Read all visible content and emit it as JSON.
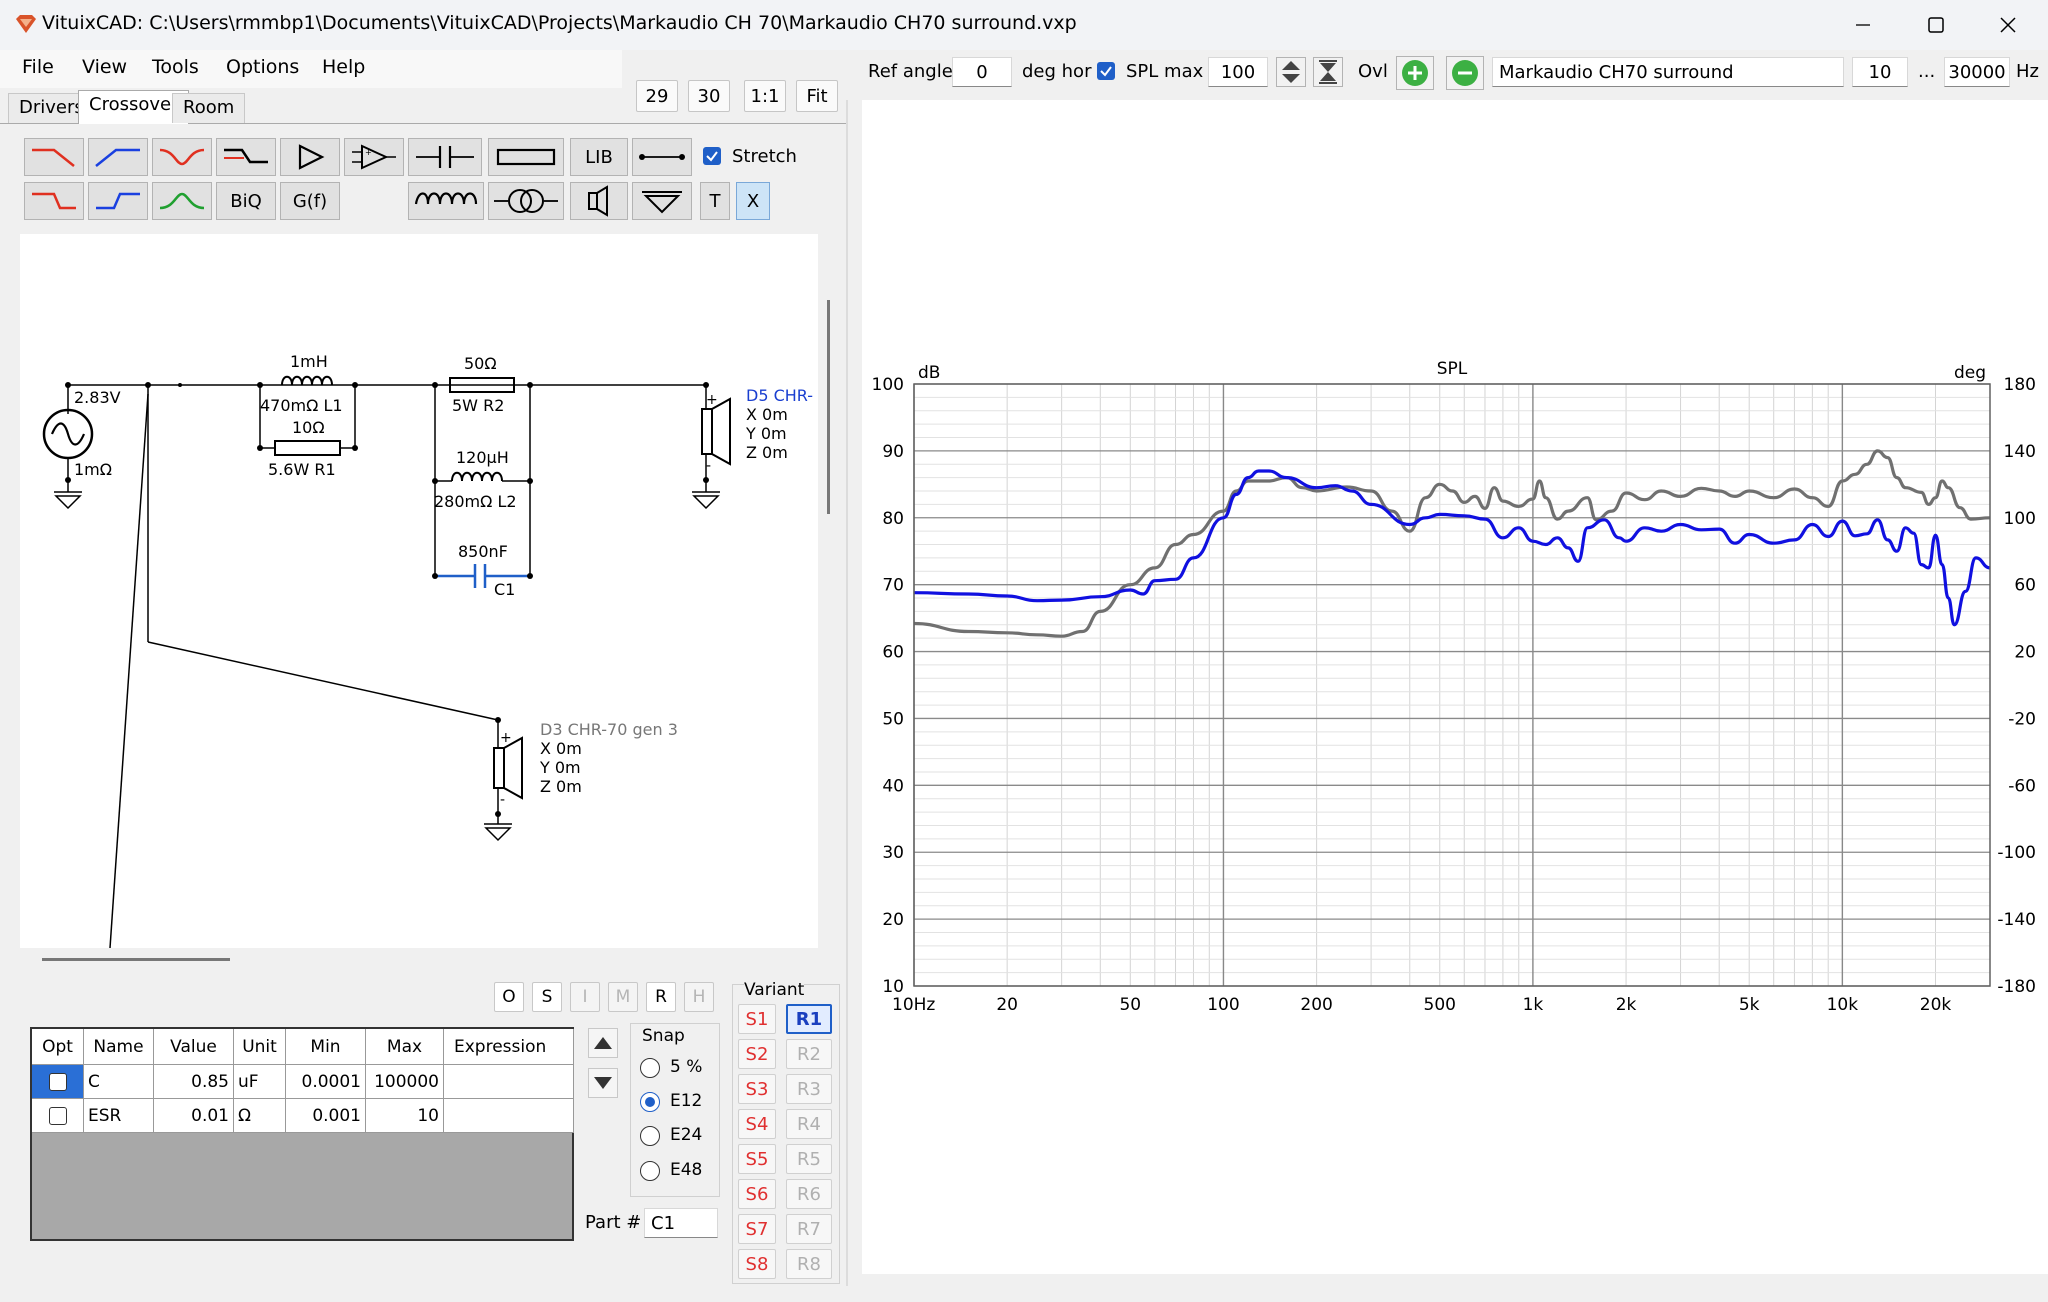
{
  "window": {
    "title": "VituixCAD: C:\\Users\\rmmbp1\\Documents\\VituixCAD\\Projects\\Markaudio CH 70\\Markaudio CH70 surround.vxp"
  },
  "menu": {
    "file": "File",
    "view": "View",
    "tools": "Tools",
    "options": "Options",
    "help": "Help"
  },
  "tabs": {
    "drivers": "Drivers",
    "crossover": "Crossover",
    "room": "Room",
    "active": "Crossover"
  },
  "zoom_buttons": {
    "b29": "29",
    "b30": "30",
    "b11": "1:1",
    "fit": "Fit"
  },
  "toolbar": {
    "lib": "LIB",
    "biq": "BiQ",
    "gf": "G(f)",
    "t": "T",
    "x": "X",
    "stretch_label": "Stretch",
    "stretch_checked": true
  },
  "schematic": {
    "source_voltage": "2.83V",
    "source_impedance": "1mΩ",
    "l1_value": "1mH",
    "l1_label": "470mΩ L1",
    "r1_value": "10Ω",
    "r1_label": "5.6W  R1",
    "r2_value": "50Ω",
    "r2_label": "5W   R2",
    "l2_value": "120µH",
    "l2_label": "280mΩ L2",
    "c1_value": "850nF",
    "c1_label": "C1",
    "d5_name": "D5 CHR-",
    "d5_x": "X 0m",
    "d5_y": "Y 0m",
    "d5_z": "Z 0m",
    "d3_name": "D3 CHR-70 gen 3",
    "d3_x": "X 0m",
    "d3_y": "Y 0m",
    "d3_z": "Z 0m"
  },
  "part_buttons": {
    "o": "O",
    "s": "S",
    "i": "I",
    "m": "M",
    "r": "R",
    "h": "H"
  },
  "param_table": {
    "headers": [
      "Opt",
      "Name",
      "Value",
      "Unit",
      "Min",
      "Max",
      "Expression"
    ],
    "rows": [
      {
        "opt": false,
        "name": "C",
        "value": "0.85",
        "unit": "uF",
        "min": "0.0001",
        "max": "100000",
        "expression": ""
      },
      {
        "opt": false,
        "name": "ESR",
        "value": "0.01",
        "unit": "Ω",
        "min": "0.001",
        "max": "10",
        "expression": ""
      }
    ]
  },
  "snap": {
    "label": "Snap",
    "options": [
      "5 %",
      "E12",
      "E24",
      "E48"
    ],
    "selected": "E12"
  },
  "part_number": {
    "label": "Part #",
    "value": "C1"
  },
  "variant": {
    "label": "Variant",
    "s": [
      "S1",
      "S2",
      "S3",
      "S4",
      "S5",
      "S6",
      "S7",
      "S8"
    ],
    "r": [
      "R1",
      "R2",
      "R3",
      "R4",
      "R5",
      "R6",
      "R7",
      "R8"
    ],
    "active": "R1"
  },
  "graph_toolbar": {
    "ref_angle_label": "Ref angle",
    "ref_angle_value": "0",
    "deg_hor_label": "deg hor",
    "spl_max_checked": true,
    "spl_max_label": "SPL max",
    "spl_max_value": "100",
    "ovl_label": "Ovl",
    "overlay_name": "Markaudio CH70 surround",
    "f_min": "10",
    "ellipsis": "...",
    "f_max": "30000",
    "hz_label": "Hz"
  },
  "chart_data": {
    "type": "line",
    "title": "SPL",
    "ylabel_left": "dB",
    "ylabel_right": "deg",
    "x_scale": "log",
    "xlim": [
      10,
      30000
    ],
    "ylim": [
      10,
      100
    ],
    "y2lim": [
      -180,
      180
    ],
    "y_ticks": [
      "100",
      "90",
      "80",
      "70",
      "60",
      "50",
      "40",
      "30",
      "20",
      "10"
    ],
    "y2_ticks": [
      "180",
      "140",
      "100",
      "60",
      "20",
      "-20",
      "-60",
      "-100",
      "-140",
      "-180"
    ],
    "x_tick_labels": [
      {
        "f": 10,
        "label": "10Hz"
      },
      {
        "f": 20,
        "label": "20"
      },
      {
        "f": 50,
        "label": "50"
      },
      {
        "f": 100,
        "label": "100"
      },
      {
        "f": 200,
        "label": "200"
      },
      {
        "f": 500,
        "label": "500"
      },
      {
        "f": 1000,
        "label": "1k"
      },
      {
        "f": 2000,
        "label": "2k"
      },
      {
        "f": 5000,
        "label": "5k"
      },
      {
        "f": 10000,
        "label": "10k"
      },
      {
        "f": 20000,
        "label": "20k"
      }
    ],
    "grid": true,
    "series": [
      {
        "color": "#1010e0",
        "points": [
          [
            10,
            68.8
          ],
          [
            15,
            68.6
          ],
          [
            20,
            68.3
          ],
          [
            25,
            67.6
          ],
          [
            30,
            67.7
          ],
          [
            40,
            68.2
          ],
          [
            50,
            69.2
          ],
          [
            55,
            68.6
          ],
          [
            60,
            70.6
          ],
          [
            70,
            70.8
          ],
          [
            80,
            74
          ],
          [
            100,
            80
          ],
          [
            110,
            83.5
          ],
          [
            120,
            86
          ],
          [
            130,
            87
          ],
          [
            140,
            87
          ],
          [
            160,
            86
          ],
          [
            200,
            84.5
          ],
          [
            230,
            84.8
          ],
          [
            260,
            84
          ],
          [
            300,
            82
          ],
          [
            400,
            79
          ],
          [
            450,
            80
          ],
          [
            500,
            80.5
          ],
          [
            600,
            80.3
          ],
          [
            700,
            79.8
          ],
          [
            800,
            77
          ],
          [
            900,
            78.5
          ],
          [
            1000,
            76.5
          ],
          [
            1100,
            76
          ],
          [
            1200,
            77
          ],
          [
            1300,
            75.5
          ],
          [
            1400,
            73.5
          ],
          [
            1500,
            78.5
          ],
          [
            1700,
            79.7
          ],
          [
            1900,
            77
          ],
          [
            2000,
            76.5
          ],
          [
            2300,
            78.5
          ],
          [
            2600,
            78
          ],
          [
            3000,
            79
          ],
          [
            3500,
            78.2
          ],
          [
            4000,
            78.3
          ],
          [
            4500,
            76.2
          ],
          [
            5000,
            77.5
          ],
          [
            6000,
            76.2
          ],
          [
            7000,
            76.7
          ],
          [
            8000,
            79
          ],
          [
            9000,
            77.2
          ],
          [
            10000,
            79.5
          ],
          [
            11000,
            77.3
          ],
          [
            12000,
            77.6
          ],
          [
            13000,
            79.7
          ],
          [
            14000,
            76.7
          ],
          [
            15000,
            75
          ],
          [
            16000,
            78.5
          ],
          [
            17000,
            77.7
          ],
          [
            18000,
            73
          ],
          [
            19000,
            72.5
          ],
          [
            20000,
            77.4
          ],
          [
            21000,
            73
          ],
          [
            22000,
            68
          ],
          [
            23000,
            64
          ],
          [
            25000,
            69
          ],
          [
            27000,
            74
          ],
          [
            30000,
            72.5
          ]
        ]
      },
      {
        "color": "#707070",
        "points": [
          [
            10,
            64.2
          ],
          [
            15,
            63
          ],
          [
            20,
            62.8
          ],
          [
            25,
            62.5
          ],
          [
            30,
            62.3
          ],
          [
            35,
            63
          ],
          [
            40,
            66
          ],
          [
            50,
            70
          ],
          [
            60,
            72.5
          ],
          [
            70,
            76
          ],
          [
            80,
            77.5
          ],
          [
            100,
            81
          ],
          [
            110,
            84
          ],
          [
            120,
            85.5
          ],
          [
            140,
            85.5
          ],
          [
            160,
            86
          ],
          [
            180,
            84.5
          ],
          [
            200,
            84
          ],
          [
            250,
            84.6
          ],
          [
            300,
            84
          ],
          [
            350,
            81
          ],
          [
            400,
            78
          ],
          [
            450,
            83
          ],
          [
            500,
            85
          ],
          [
            550,
            84
          ],
          [
            600,
            82.3
          ],
          [
            650,
            83.2
          ],
          [
            700,
            81.4
          ],
          [
            750,
            84.5
          ],
          [
            800,
            82.5
          ],
          [
            900,
            81.7
          ],
          [
            1000,
            82.8
          ],
          [
            1050,
            85.5
          ],
          [
            1100,
            83
          ],
          [
            1200,
            79.8
          ],
          [
            1300,
            81
          ],
          [
            1500,
            83
          ],
          [
            1600,
            79.7
          ],
          [
            1800,
            81
          ],
          [
            2000,
            83.7
          ],
          [
            2300,
            82.7
          ],
          [
            2600,
            84
          ],
          [
            3000,
            83.2
          ],
          [
            3500,
            84.4
          ],
          [
            4000,
            84
          ],
          [
            4500,
            83.2
          ],
          [
            5000,
            84
          ],
          [
            6000,
            83
          ],
          [
            7000,
            84.3
          ],
          [
            8000,
            83
          ],
          [
            9000,
            81.7
          ],
          [
            10000,
            85.5
          ],
          [
            11000,
            86.5
          ],
          [
            12000,
            88
          ],
          [
            13000,
            90
          ],
          [
            14000,
            89
          ],
          [
            15000,
            86
          ],
          [
            16000,
            84.5
          ],
          [
            18000,
            83.8
          ],
          [
            19000,
            82
          ],
          [
            20000,
            83
          ],
          [
            21000,
            85.5
          ],
          [
            22000,
            84.5
          ],
          [
            24000,
            81.5
          ],
          [
            26000,
            79.8
          ],
          [
            30000,
            80
          ]
        ]
      }
    ]
  }
}
